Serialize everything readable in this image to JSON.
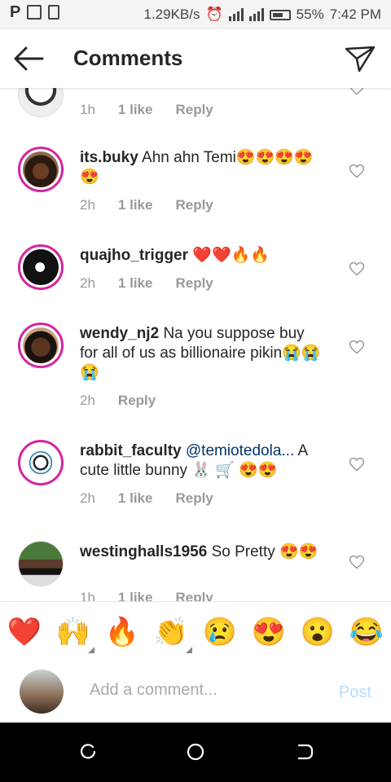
{
  "status_bar": {
    "net_speed": "1.29KB/s",
    "battery": "55%",
    "time": "7:42 PM"
  },
  "header": {
    "title": "Comments"
  },
  "comments": [
    {
      "username": "",
      "text": "",
      "time": "1h",
      "likes": "1 like",
      "reply": "Reply"
    },
    {
      "username": "its.buky",
      "text": "Ahn ahn Temi😍😍😍😍😍",
      "time": "2h",
      "likes": "1 like",
      "reply": "Reply"
    },
    {
      "username": "quajho_trigger",
      "text": "❤️❤️🔥🔥",
      "time": "2h",
      "likes": "1 like",
      "reply": "Reply"
    },
    {
      "username": "wendy_nj2",
      "text": "Na you suppose buy for all of us as billionaire pikin😭😭😭",
      "time": "2h",
      "reply": "Reply"
    },
    {
      "username": "rabbit_faculty",
      "mention": "@temiotedola...",
      "text": " A cute little bunny 🐰 🛒 😍😍",
      "time": "2h",
      "likes": "1 like",
      "reply": "Reply"
    },
    {
      "username": "westinghalls1956",
      "text": "So Pretty 😍😍",
      "time": "1h",
      "likes": "1 like",
      "reply": "Reply"
    }
  ],
  "emoji_bar": [
    "❤️",
    "🙌",
    "🔥",
    "👏",
    "😢",
    "😍",
    "😮",
    "😂"
  ],
  "add_comment": {
    "placeholder": "Add a comment...",
    "post_label": "Post"
  },
  "colors": {
    "story_ring": "#d6249f",
    "post_disabled": "#b3dbff",
    "mention": "#003569"
  }
}
